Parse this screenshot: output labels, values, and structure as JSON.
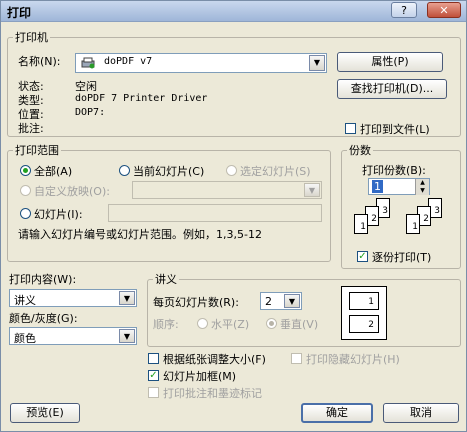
{
  "window": {
    "title": "打印",
    "help_glyph": "?",
    "close_glyph": "✕"
  },
  "printer": {
    "group": "打印机",
    "name_label": "名称(N):",
    "name_value": "doPDF v7",
    "properties_btn": "属性(P)",
    "status_label": "状态:",
    "status_value": "空闲",
    "type_label": "类型:",
    "type_value": "doPDF 7 Printer Driver",
    "where_label": "位置:",
    "where_value": "DOP7:",
    "comment_label": "批注:",
    "find_btn": "查找打印机(D)...",
    "print_to_file": "打印到文件(L)"
  },
  "range": {
    "group": "打印范围",
    "all": "全部(A)",
    "current": "当前幻灯片(C)",
    "selection": "选定幻灯片(S)",
    "custom_show": "自定义放映(O):",
    "slides": "幻灯片(I):",
    "hint": "请输入幻灯片编号或幻灯片范围。例如，1,3,5-12"
  },
  "copies": {
    "group": "份数",
    "count_label": "打印份数(B):",
    "count_value": "1",
    "collate": "逐份打印(T)"
  },
  "print_what": {
    "label": "打印内容(W):",
    "value": "讲义"
  },
  "color": {
    "label": "颜色/灰度(G):",
    "value": "颜色"
  },
  "handouts": {
    "group": "讲义",
    "per_page_label": "每页幻灯片数(R):",
    "per_page_value": "2",
    "order_label": "顺序:",
    "horizontal": "水平(Z)",
    "vertical": "垂直(V)"
  },
  "options": {
    "scale": "根据纸张调整大小(F)",
    "hidden": "打印隐藏幻灯片(H)",
    "frame": "幻灯片加框(M)",
    "comments": "打印批注和墨迹标记"
  },
  "buttons": {
    "preview": "预览(E)",
    "ok": "确定",
    "cancel": "取消"
  }
}
